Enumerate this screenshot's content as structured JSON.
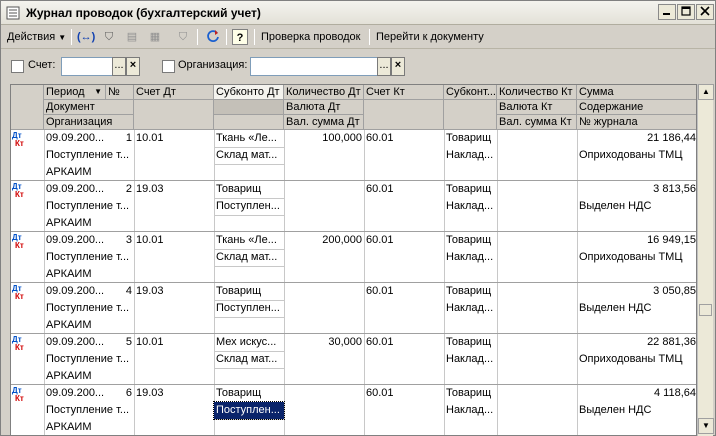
{
  "window": {
    "title": "Журнал проводок (бухгалтерский учет)"
  },
  "toolbar": {
    "actions_label": "Действия",
    "check_label": "Проверка проводок",
    "goto_doc_label": "Перейти к документу",
    "help_label": "?"
  },
  "filters": {
    "account_label": "Счет:",
    "org_label": "Организация:",
    "account_value": "",
    "org_value": "",
    "browse": "...",
    "clear": "×"
  },
  "columns": {
    "period": "Период",
    "no": "№",
    "document": "Документ",
    "organization": "Организация",
    "acc_dt": "Счет Дт",
    "subconto_dt": "Субконто Дт",
    "qty_dt": "Количество Дт",
    "cur_dt": "Валюта Дт",
    "cur_sum_dt": "Вал. сумма Дт",
    "acc_kt": "Счет Кт",
    "subconto_kt": "Субконт...",
    "qty_kt": "Количество Кт",
    "cur_kt": "Валюта Кт",
    "cur_sum_kt": "Вал. сумма Кт",
    "sum": "Сумма",
    "content": "Содержание",
    "journal_no": "№ журнала"
  },
  "row_icon": {
    "dt": "Дт",
    "kt": "Кт"
  },
  "rows": [
    {
      "period": "09.09.200...",
      "no": "1",
      "acc_dt": "10.01",
      "sub_dt_1": "Ткань «Ле...",
      "qty_dt": "100,000",
      "acc_kt": "60.01",
      "sub_kt_1": "Товарищ",
      "sum": "21 186,44",
      "document": "Поступление т...",
      "sub_dt_2": "Склад мат...",
      "sub_kt_2": "Наклад...",
      "content": "Оприходованы ТМЦ",
      "organization": "АРКАИМ"
    },
    {
      "period": "09.09.200...",
      "no": "2",
      "acc_dt": "19.03",
      "sub_dt_1": "Товарищ",
      "qty_dt": "",
      "acc_kt": "60.01",
      "sub_kt_1": "Товарищ",
      "sum": "3 813,56",
      "document": "Поступление т...",
      "sub_dt_2": "Поступлен...",
      "sub_kt_2": "Наклад...",
      "content": "Выделен НДС",
      "organization": "АРКАИМ"
    },
    {
      "period": "09.09.200...",
      "no": "3",
      "acc_dt": "10.01",
      "sub_dt_1": "Ткань «Ле...",
      "qty_dt": "200,000",
      "acc_kt": "60.01",
      "sub_kt_1": "Товарищ",
      "sum": "16 949,15",
      "document": "Поступление т...",
      "sub_dt_2": "Склад мат...",
      "sub_kt_2": "Наклад...",
      "content": "Оприходованы ТМЦ",
      "organization": "АРКАИМ"
    },
    {
      "period": "09.09.200...",
      "no": "4",
      "acc_dt": "19.03",
      "sub_dt_1": "Товарищ",
      "qty_dt": "",
      "acc_kt": "60.01",
      "sub_kt_1": "Товарищ",
      "sum": "3 050,85",
      "document": "Поступление т...",
      "sub_dt_2": "Поступлен...",
      "sub_kt_2": "Наклад...",
      "content": "Выделен НДС",
      "organization": "АРКАИМ"
    },
    {
      "period": "09.09.200...",
      "no": "5",
      "acc_dt": "10.01",
      "sub_dt_1": "Мех искус...",
      "qty_dt": "30,000",
      "acc_kt": "60.01",
      "sub_kt_1": "Товарищ",
      "sum": "22 881,36",
      "document": "Поступление т...",
      "sub_dt_2": "Склад мат...",
      "sub_kt_2": "Наклад...",
      "content": "Оприходованы ТМЦ",
      "organization": "АРКАИМ"
    },
    {
      "period": "09.09.200...",
      "no": "6",
      "acc_dt": "19.03",
      "sub_dt_1": "Товарищ",
      "qty_dt": "",
      "acc_kt": "60.01",
      "sub_kt_1": "Товарищ",
      "sum": "4 118,64",
      "document": "Поступление т...",
      "sub_dt_2": "Поступлен...",
      "sub_kt_2": "Наклад...",
      "content": "Выделен НДС",
      "organization": "АРКАИМ"
    }
  ]
}
